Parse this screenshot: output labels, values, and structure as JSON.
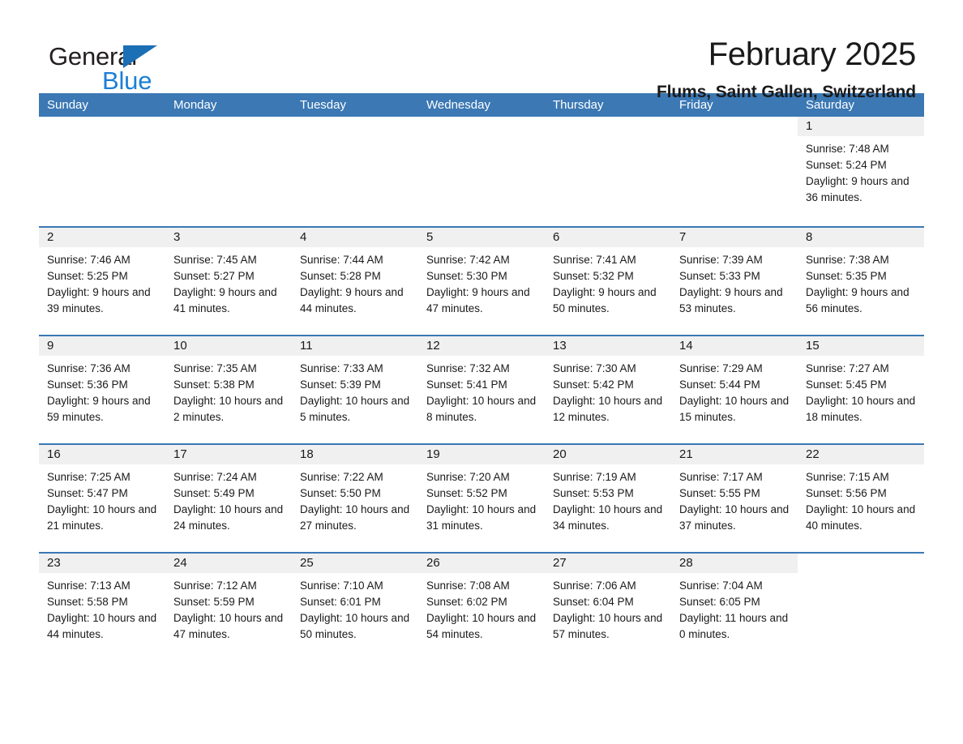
{
  "brand": {
    "name_part1": "General",
    "name_part2": "Blue",
    "accent_color": "#1b7fd4",
    "triangle_color": "#1b6fb5"
  },
  "header": {
    "title": "February 2025",
    "location": "Flums, Saint Gallen, Switzerland",
    "header_bg_color": "#3b78b4",
    "row_divider_color": "#3b78b4",
    "datenum_bg_color": "#f0f0f0"
  },
  "weekdays": [
    "Sunday",
    "Monday",
    "Tuesday",
    "Wednesday",
    "Thursday",
    "Friday",
    "Saturday"
  ],
  "weeks": [
    [
      {
        "blank": true,
        "day": "",
        "sunrise": "",
        "sunset": "",
        "daylight": ""
      },
      {
        "blank": true,
        "day": "",
        "sunrise": "",
        "sunset": "",
        "daylight": ""
      },
      {
        "blank": true,
        "day": "",
        "sunrise": "",
        "sunset": "",
        "daylight": ""
      },
      {
        "blank": true,
        "day": "",
        "sunrise": "",
        "sunset": "",
        "daylight": ""
      },
      {
        "blank": true,
        "day": "",
        "sunrise": "",
        "sunset": "",
        "daylight": ""
      },
      {
        "blank": true,
        "day": "",
        "sunrise": "",
        "sunset": "",
        "daylight": ""
      },
      {
        "blank": false,
        "day": "1",
        "sunrise": "Sunrise: 7:48 AM",
        "sunset": "Sunset: 5:24 PM",
        "daylight": "Daylight: 9 hours and 36 minutes."
      }
    ],
    [
      {
        "blank": false,
        "day": "2",
        "sunrise": "Sunrise: 7:46 AM",
        "sunset": "Sunset: 5:25 PM",
        "daylight": "Daylight: 9 hours and 39 minutes."
      },
      {
        "blank": false,
        "day": "3",
        "sunrise": "Sunrise: 7:45 AM",
        "sunset": "Sunset: 5:27 PM",
        "daylight": "Daylight: 9 hours and 41 minutes."
      },
      {
        "blank": false,
        "day": "4",
        "sunrise": "Sunrise: 7:44 AM",
        "sunset": "Sunset: 5:28 PM",
        "daylight": "Daylight: 9 hours and 44 minutes."
      },
      {
        "blank": false,
        "day": "5",
        "sunrise": "Sunrise: 7:42 AM",
        "sunset": "Sunset: 5:30 PM",
        "daylight": "Daylight: 9 hours and 47 minutes."
      },
      {
        "blank": false,
        "day": "6",
        "sunrise": "Sunrise: 7:41 AM",
        "sunset": "Sunset: 5:32 PM",
        "daylight": "Daylight: 9 hours and 50 minutes."
      },
      {
        "blank": false,
        "day": "7",
        "sunrise": "Sunrise: 7:39 AM",
        "sunset": "Sunset: 5:33 PM",
        "daylight": "Daylight: 9 hours and 53 minutes."
      },
      {
        "blank": false,
        "day": "8",
        "sunrise": "Sunrise: 7:38 AM",
        "sunset": "Sunset: 5:35 PM",
        "daylight": "Daylight: 9 hours and 56 minutes."
      }
    ],
    [
      {
        "blank": false,
        "day": "9",
        "sunrise": "Sunrise: 7:36 AM",
        "sunset": "Sunset: 5:36 PM",
        "daylight": "Daylight: 9 hours and 59 minutes."
      },
      {
        "blank": false,
        "day": "10",
        "sunrise": "Sunrise: 7:35 AM",
        "sunset": "Sunset: 5:38 PM",
        "daylight": "Daylight: 10 hours and 2 minutes."
      },
      {
        "blank": false,
        "day": "11",
        "sunrise": "Sunrise: 7:33 AM",
        "sunset": "Sunset: 5:39 PM",
        "daylight": "Daylight: 10 hours and 5 minutes."
      },
      {
        "blank": false,
        "day": "12",
        "sunrise": "Sunrise: 7:32 AM",
        "sunset": "Sunset: 5:41 PM",
        "daylight": "Daylight: 10 hours and 8 minutes."
      },
      {
        "blank": false,
        "day": "13",
        "sunrise": "Sunrise: 7:30 AM",
        "sunset": "Sunset: 5:42 PM",
        "daylight": "Daylight: 10 hours and 12 minutes."
      },
      {
        "blank": false,
        "day": "14",
        "sunrise": "Sunrise: 7:29 AM",
        "sunset": "Sunset: 5:44 PM",
        "daylight": "Daylight: 10 hours and 15 minutes."
      },
      {
        "blank": false,
        "day": "15",
        "sunrise": "Sunrise: 7:27 AM",
        "sunset": "Sunset: 5:45 PM",
        "daylight": "Daylight: 10 hours and 18 minutes."
      }
    ],
    [
      {
        "blank": false,
        "day": "16",
        "sunrise": "Sunrise: 7:25 AM",
        "sunset": "Sunset: 5:47 PM",
        "daylight": "Daylight: 10 hours and 21 minutes."
      },
      {
        "blank": false,
        "day": "17",
        "sunrise": "Sunrise: 7:24 AM",
        "sunset": "Sunset: 5:49 PM",
        "daylight": "Daylight: 10 hours and 24 minutes."
      },
      {
        "blank": false,
        "day": "18",
        "sunrise": "Sunrise: 7:22 AM",
        "sunset": "Sunset: 5:50 PM",
        "daylight": "Daylight: 10 hours and 27 minutes."
      },
      {
        "blank": false,
        "day": "19",
        "sunrise": "Sunrise: 7:20 AM",
        "sunset": "Sunset: 5:52 PM",
        "daylight": "Daylight: 10 hours and 31 minutes."
      },
      {
        "blank": false,
        "day": "20",
        "sunrise": "Sunrise: 7:19 AM",
        "sunset": "Sunset: 5:53 PM",
        "daylight": "Daylight: 10 hours and 34 minutes."
      },
      {
        "blank": false,
        "day": "21",
        "sunrise": "Sunrise: 7:17 AM",
        "sunset": "Sunset: 5:55 PM",
        "daylight": "Daylight: 10 hours and 37 minutes."
      },
      {
        "blank": false,
        "day": "22",
        "sunrise": "Sunrise: 7:15 AM",
        "sunset": "Sunset: 5:56 PM",
        "daylight": "Daylight: 10 hours and 40 minutes."
      }
    ],
    [
      {
        "blank": false,
        "day": "23",
        "sunrise": "Sunrise: 7:13 AM",
        "sunset": "Sunset: 5:58 PM",
        "daylight": "Daylight: 10 hours and 44 minutes."
      },
      {
        "blank": false,
        "day": "24",
        "sunrise": "Sunrise: 7:12 AM",
        "sunset": "Sunset: 5:59 PM",
        "daylight": "Daylight: 10 hours and 47 minutes."
      },
      {
        "blank": false,
        "day": "25",
        "sunrise": "Sunrise: 7:10 AM",
        "sunset": "Sunset: 6:01 PM",
        "daylight": "Daylight: 10 hours and 50 minutes."
      },
      {
        "blank": false,
        "day": "26",
        "sunrise": "Sunrise: 7:08 AM",
        "sunset": "Sunset: 6:02 PM",
        "daylight": "Daylight: 10 hours and 54 minutes."
      },
      {
        "blank": false,
        "day": "27",
        "sunrise": "Sunrise: 7:06 AM",
        "sunset": "Sunset: 6:04 PM",
        "daylight": "Daylight: 10 hours and 57 minutes."
      },
      {
        "blank": false,
        "day": "28",
        "sunrise": "Sunrise: 7:04 AM",
        "sunset": "Sunset: 6:05 PM",
        "daylight": "Daylight: 11 hours and 0 minutes."
      },
      {
        "blank": true,
        "day": "",
        "sunrise": "",
        "sunset": "",
        "daylight": ""
      }
    ]
  ]
}
